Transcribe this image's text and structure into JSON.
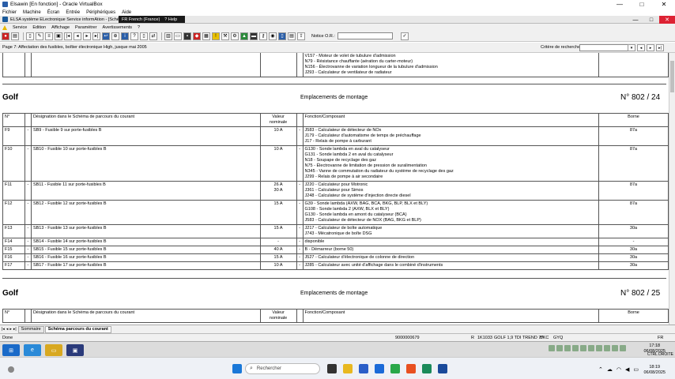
{
  "vbox": {
    "title": "Elsawin [En fonction] - Oracle VirtualBox",
    "menu": [
      "Fichier",
      "Machine",
      "Écran",
      "Entrée",
      "Périphériques",
      "Aide"
    ],
    "controls": [
      "—",
      "□",
      "✕"
    ]
  },
  "elsa": {
    "title": "ELSA système ELectronique Service informAtion - [Schéma",
    "overlay": [
      "FR French (France)",
      "? Help"
    ],
    "menu": [
      "Service",
      "Edition",
      "Affichage",
      "Paramètrer",
      "Avertissements",
      "?"
    ],
    "notice_label": "Notice O.R.:",
    "page_label": "Page 7: Affectation des fusibles, boîtier électronique High, jusque mai 2005",
    "search_label": "Critère de recherche:"
  },
  "doc": {
    "top_rows": [
      "V157 - Moteur de volet de tubulure d'admission",
      "N79 - Résistance chauffante (aération du carter-moteur)",
      "N156 - Électrovanne de variation longueur de la tubulure d'admission",
      "J293 - Calculateur de ventilateur de radiateur"
    ],
    "section1": {
      "title": "Golf",
      "mid": "Emplacements de montage",
      "num": "N°  802 / 24"
    },
    "section2": {
      "title": "Golf",
      "mid": "Emplacements de montage",
      "num": "N°  802 / 25"
    },
    "headers": {
      "n": "N°",
      "des": "Désignation dans le Schéma de parcours du courant",
      "val1": "Valeur",
      "val2": "nominale",
      "fn": "Fonction/Composant",
      "b": "Borne"
    },
    "rows": [
      {
        "n": "F9",
        "des": "SB9 - Fusible 9 sur porte-fusibles B",
        "val": "10 A",
        "fn": [
          "J583 - Calculateur de détecteur de NOx",
          "J179 - Calculateur d'automatisme de temps de préchauffage",
          "J17 - Relais de pompe à carburant"
        ],
        "b": "87a"
      },
      {
        "n": "F10",
        "des": "SB10 - Fusible 10 sur porte-fusibles B",
        "val": "10 A",
        "fn": [
          "G130 - Sonde lambda en aval du catalyseur",
          "G131 - Sonde lambda 2 en aval du catalyseur",
          "N18 - Soupape de recyclage des gaz",
          "N75 - Électrovanne de limitation de pression de suralimentation",
          "N345 - Vanne de commutation du radiateur du système de recyclage des gaz",
          "J299 - Relais de pompe à air secondaire"
        ],
        "b": "87a"
      },
      {
        "n": "F11",
        "des": "SB11 - Fusible 11 sur porte-fusibles B",
        "val": "26 A\n30 A",
        "fn": [
          "J220 - Calculateur pour Motronic",
          "J361 - Calculateur pour Simos",
          "J248 - Calculateur de système d'injection directe diesel"
        ],
        "b": "87a"
      },
      {
        "n": "F12",
        "des": "SB12 - Fusible 12 sur porte-fusibles B",
        "val": "15 A",
        "fn": [
          "G39 - Sonde lambda (AXW, BAG, BCA, BKG, BLP, BLX et BLY)",
          "G108 - Sonde lambda 2 (AXW, BLX et BLY)",
          "G130 - Sonde lambda en amont du catalyseur (BCA)",
          "J583 - Calculateur de détecteur de NOX (BAG, BKG et BLP)"
        ],
        "b": "87a"
      },
      {
        "n": "F13",
        "des": "SB13 - Fusible 13 sur porte-fusibles B",
        "val": "15 A",
        "fn": [
          "J217 - Calculateur de boîte automatique",
          "J743 - Mécatronique de boîte DSG"
        ],
        "b": "30a"
      },
      {
        "n": "F14",
        "des": "SB14 - Fusible 14 sur porte-fusibles B",
        "val": "-",
        "fn": [
          "disponible"
        ],
        "b": "-"
      },
      {
        "n": "F15",
        "des": "SB15 - Fusible 15 sur porte-fusibles B",
        "val": "40 A",
        "fn": [
          "B - Démarreur (borne 50)"
        ],
        "b": "30a"
      },
      {
        "n": "F16",
        "des": "SB16 - Fusible 16 sur porte-fusibles B",
        "val": "15 A",
        "fn": [
          "J527 - Calculateur d'électronique de colonne de direction"
        ],
        "b": "30a"
      },
      {
        "n": "F17",
        "des": "SB17 - Fusible 17 sur porte-fusibles B",
        "val": "10 A",
        "fn": [
          "J285 - Calculateur avec unité d'affichage dans le combiné d'instruments"
        ],
        "b": "30a"
      }
    ]
  },
  "tabs": [
    "Sommaire",
    "Schéma parcours du courant"
  ],
  "status": {
    "left": "Done",
    "code": "9000000679",
    "fields": [
      "R",
      "1K1033",
      "GOLF 1,9 TDI TREND 77",
      "BKC",
      "GYQ"
    ],
    "lang": "FR"
  },
  "vbox_status": {
    "time": "17:18",
    "date": "06/08/2025",
    "host_key": "CTRL DROITE"
  },
  "taskbar": {
    "search": "Rechercher",
    "time": "18:19",
    "date": "06/08/2025"
  }
}
